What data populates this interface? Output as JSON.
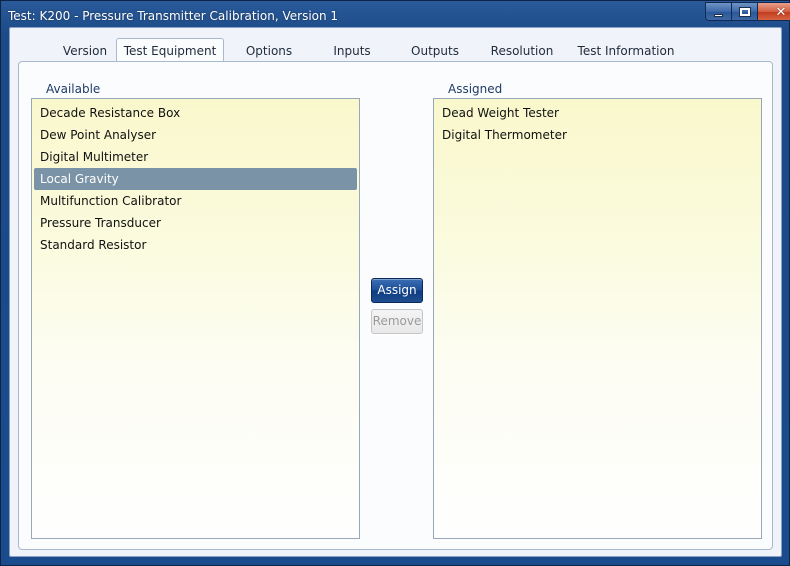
{
  "window": {
    "title": "Test: K200 - Pressure Transmitter Calibration, Version 1",
    "controls": {
      "minimize_icon": "minimize-icon",
      "maximize_icon": "maximize-icon",
      "close_icon": "close-icon",
      "close_glyph": "✕"
    }
  },
  "tabs": [
    {
      "label": "Version",
      "active": false
    },
    {
      "label": "Test Equipment",
      "active": true
    },
    {
      "label": "Options",
      "active": false
    },
    {
      "label": "Inputs",
      "active": false
    },
    {
      "label": "Outputs",
      "active": false
    },
    {
      "label": "Resolution",
      "active": false
    },
    {
      "label": "Test Information",
      "active": false
    }
  ],
  "available": {
    "label": "Available",
    "items": [
      {
        "label": "Decade Resistance Box",
        "selected": false
      },
      {
        "label": "Dew Point Analyser",
        "selected": false
      },
      {
        "label": "Digital Multimeter",
        "selected": false
      },
      {
        "label": "Local Gravity",
        "selected": true
      },
      {
        "label": "Multifunction Calibrator",
        "selected": false
      },
      {
        "label": "Pressure Transducer",
        "selected": false
      },
      {
        "label": "Standard Resistor",
        "selected": false
      }
    ]
  },
  "assigned": {
    "label": "Assigned",
    "items": [
      {
        "label": "Dead Weight Tester",
        "selected": false
      },
      {
        "label": "Digital Thermometer",
        "selected": false
      }
    ]
  },
  "buttons": {
    "assign_label": "Assign",
    "remove_label": "Remove",
    "remove_enabled": false
  },
  "colors": {
    "selection": "#7b93a6",
    "primary_button": "#1b4d95",
    "list_background": "#f9f8cc"
  }
}
